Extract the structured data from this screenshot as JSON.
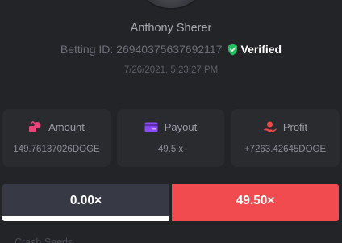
{
  "profile": {
    "username": "Anthony Sherer",
    "betting_id": "Betting ID: 26940375637692117",
    "verified_label": "Verified",
    "timestamp": "7/26/2021, 5:23:27 PM"
  },
  "stats": {
    "amount": {
      "label": "Amount",
      "value": "149.76137026DOGE",
      "icon": "coins-icon"
    },
    "payout": {
      "label": "Payout",
      "value": "49.5 x",
      "icon": "wallet-icon"
    },
    "profit": {
      "label": "Profit",
      "value": "+7263.42645DOGE",
      "icon": "profit-hand-icon"
    }
  },
  "multipliers": {
    "left": "0.00×",
    "right": "49.50×"
  },
  "footer": {
    "partial_text": "Crash Seeds"
  },
  "colors": {
    "background": "#232427",
    "card": "#2a2b2f",
    "amount_icon": "#e8457a",
    "payout_icon": "#8a4cf0",
    "profit_icon": "#ee4a46",
    "verified_shield": "#1fc15c",
    "multiplier_right": "#f14a4f",
    "multiplier_left": "#373a44"
  }
}
